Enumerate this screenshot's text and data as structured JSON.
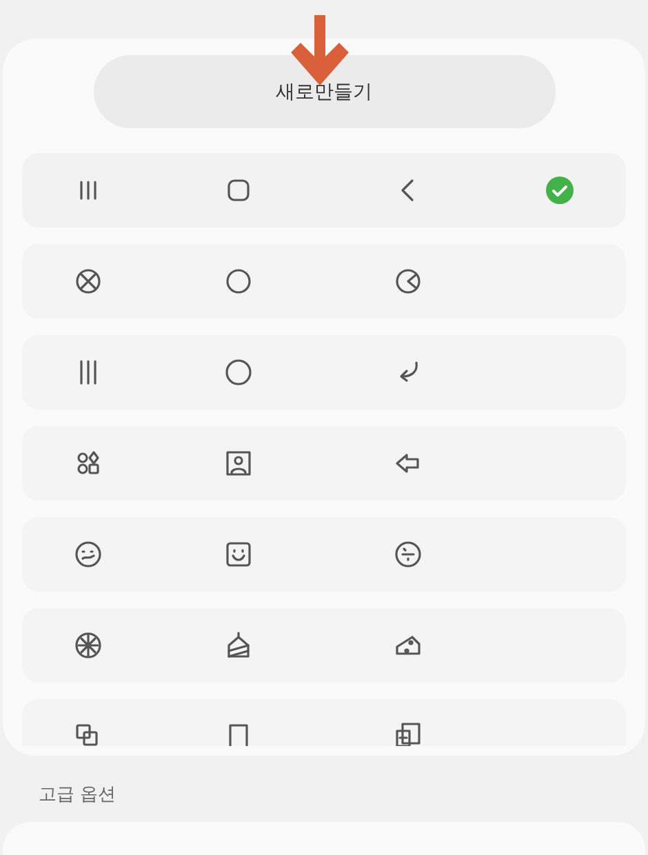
{
  "create_button": {
    "label": "새로만들기"
  },
  "button_styles": [
    {
      "selected": true
    },
    {
      "selected": false
    },
    {
      "selected": false
    },
    {
      "selected": false
    },
    {
      "selected": false
    },
    {
      "selected": false
    },
    {
      "selected": false
    }
  ],
  "advanced_options": {
    "title": "고급 옵션"
  }
}
